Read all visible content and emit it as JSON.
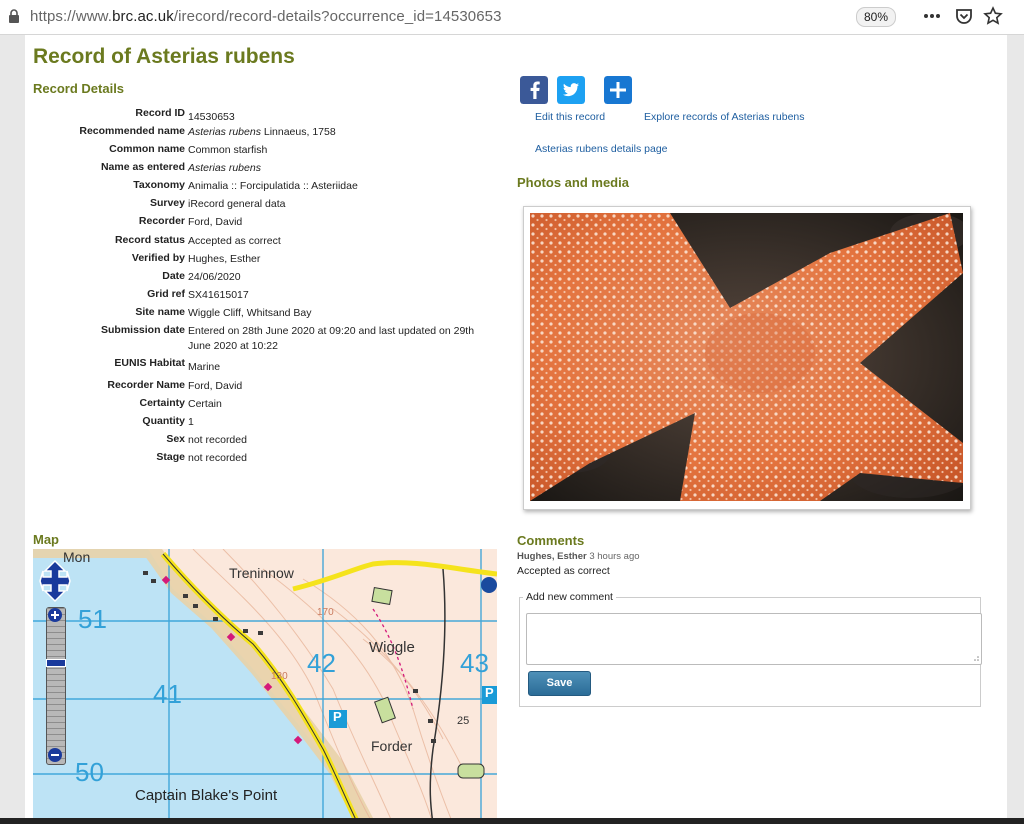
{
  "browser": {
    "url_prefix": "https://www.",
    "url_host": "brc.ac.uk",
    "url_path": "/irecord/record-details?occurrence_id=14530653",
    "zoom": "80%",
    "icons": [
      "lock-icon",
      "more-icon",
      "pocket-icon",
      "star-icon"
    ]
  },
  "page": {
    "title": "Record of Asterias rubens",
    "details_heading": "Record Details",
    "photos_heading": "Photos and media",
    "map_heading": "Map",
    "comments_heading": "Comments"
  },
  "details": [
    {
      "label": "Record ID",
      "value": "14530653"
    },
    {
      "label": "Recommended name",
      "value_italic": "Asterias rubens",
      "value": " Linnaeus, 1758"
    },
    {
      "label": "Common name",
      "value": "Common starfish"
    },
    {
      "label": "Name as entered",
      "value_italic": "Asterias rubens",
      "value": ""
    },
    {
      "label": "Taxonomy",
      "value": "Animalia :: Forcipulatida :: Asteriidae"
    },
    {
      "label": "Survey",
      "value": "iRecord general data"
    },
    {
      "label": "Recorder",
      "value": "Ford, David"
    },
    {
      "label": "Record status",
      "value": "Accepted as correct"
    },
    {
      "label": "Verified by",
      "value": "Hughes, Esther"
    },
    {
      "label": "Date",
      "value": "24/06/2020"
    },
    {
      "label": "Grid ref",
      "value": "SX41615017"
    },
    {
      "label": "Site name",
      "value": "Wiggle Cliff, Whitsand Bay"
    },
    {
      "label": "Submission date",
      "value": "Entered on 28th June 2020 at 09:20 and last updated on 29th June 2020 at 10:22"
    },
    {
      "label": "EUNIS Habitat",
      "value": "Marine"
    },
    {
      "label": "Recorder Name",
      "value": "Ford, David"
    },
    {
      "label": "Certainty",
      "value": "Certain"
    },
    {
      "label": "Quantity",
      "value": "1"
    },
    {
      "label": "Sex",
      "value": "not recorded"
    },
    {
      "label": "Stage",
      "value": "not recorded"
    }
  ],
  "actions": {
    "social": [
      {
        "name": "facebook-share-icon",
        "color": "#3b5998"
      },
      {
        "name": "twitter-share-icon",
        "color": "#1da1f2"
      },
      {
        "name": "add-share-icon",
        "color": "#1877d2"
      }
    ],
    "edit_record": "Edit this record",
    "explore_records": "Explore records of Asterias rubens",
    "details_page": "Asterias rubens details page"
  },
  "map": {
    "labels": {
      "mon": "Mon",
      "treninnow": "Treninnow",
      "wiggle": "Wiggle",
      "forder": "Forder",
      "captain": "Captain Blake's Point",
      "grid_51": "51",
      "grid_50": "50",
      "grid_41": "41",
      "grid_42": "42",
      "grid_43": "43",
      "parking": "P",
      "contour_25": "25",
      "contour_170": "170",
      "contour_130": "130"
    },
    "controls": [
      "pan-control-icon",
      "zoom-in-icon",
      "zoom-out-icon"
    ]
  },
  "comments": [
    {
      "author": "Hughes, Esther",
      "time": "3 hours ago",
      "text": "Accepted as correct"
    }
  ],
  "comment_form": {
    "legend": "Add new comment",
    "save": "Save"
  },
  "colors": {
    "heading": "#6b7a1f",
    "link": "#1e5ea0",
    "sea": "#bde3f5",
    "land": "#fbe8dc"
  }
}
